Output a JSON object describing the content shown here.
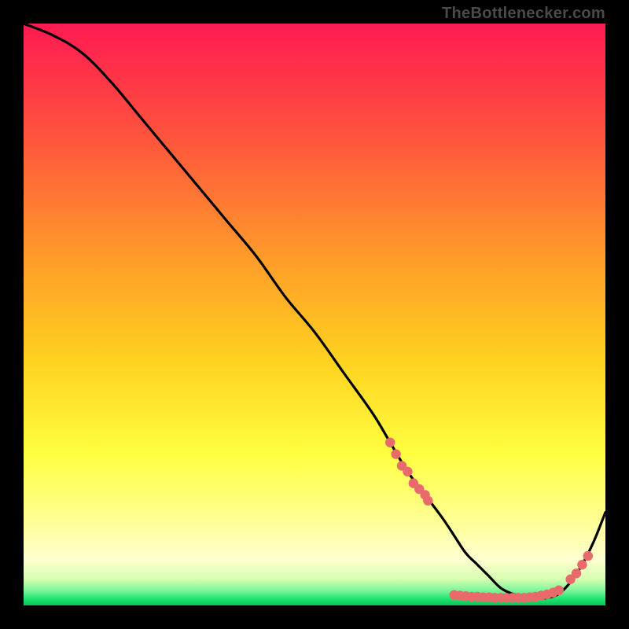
{
  "attribution": "TheBottlenecker.com",
  "colors": {
    "top": "#ff1a52",
    "mid_upper": "#ff7a2e",
    "mid": "#ffd21f",
    "mid_lower": "#ffff40",
    "pale": "#ffffc0",
    "green": "#17e36b",
    "line": "#000000",
    "dot": "#e86a6a",
    "frame": "#000000"
  },
  "chart_data": {
    "type": "line",
    "title": "",
    "xlabel": "",
    "ylabel": "",
    "xlim": [
      0,
      100
    ],
    "ylim": [
      0,
      100
    ],
    "series": [
      {
        "name": "curve",
        "x": [
          0,
          5,
          10,
          15,
          20,
          25,
          30,
          35,
          40,
          45,
          50,
          55,
          60,
          63,
          66,
          69,
          72,
          74,
          76,
          78,
          80,
          82,
          84,
          86,
          88,
          90,
          92,
          94,
          96,
          98,
          100
        ],
        "y": [
          100,
          98,
          95,
          90,
          84,
          78,
          72,
          66,
          60,
          53,
          47,
          40,
          33,
          28,
          23,
          19,
          15,
          12,
          9,
          7,
          5,
          3,
          2,
          1.5,
          1.3,
          1.3,
          2,
          4,
          7,
          11,
          16
        ]
      }
    ],
    "marker_clusters": [
      {
        "name": "left-cluster",
        "x": [
          63,
          64,
          65,
          66,
          67,
          68,
          69,
          69.5
        ],
        "y": [
          28,
          26,
          24,
          23,
          21,
          20,
          19,
          18
        ]
      },
      {
        "name": "bottom-cluster",
        "x": [
          74,
          75,
          76,
          77,
          78,
          79,
          80,
          81,
          82,
          83,
          84,
          85,
          86,
          87,
          88,
          89,
          90,
          91,
          92
        ],
        "y": [
          1.8,
          1.7,
          1.6,
          1.5,
          1.5,
          1.4,
          1.4,
          1.3,
          1.3,
          1.3,
          1.3,
          1.3,
          1.3,
          1.4,
          1.5,
          1.7,
          1.9,
          2.2,
          2.6
        ]
      },
      {
        "name": "right-cluster",
        "x": [
          94,
          95,
          96,
          97
        ],
        "y": [
          4.5,
          5.5,
          7,
          8.5
        ]
      }
    ]
  }
}
